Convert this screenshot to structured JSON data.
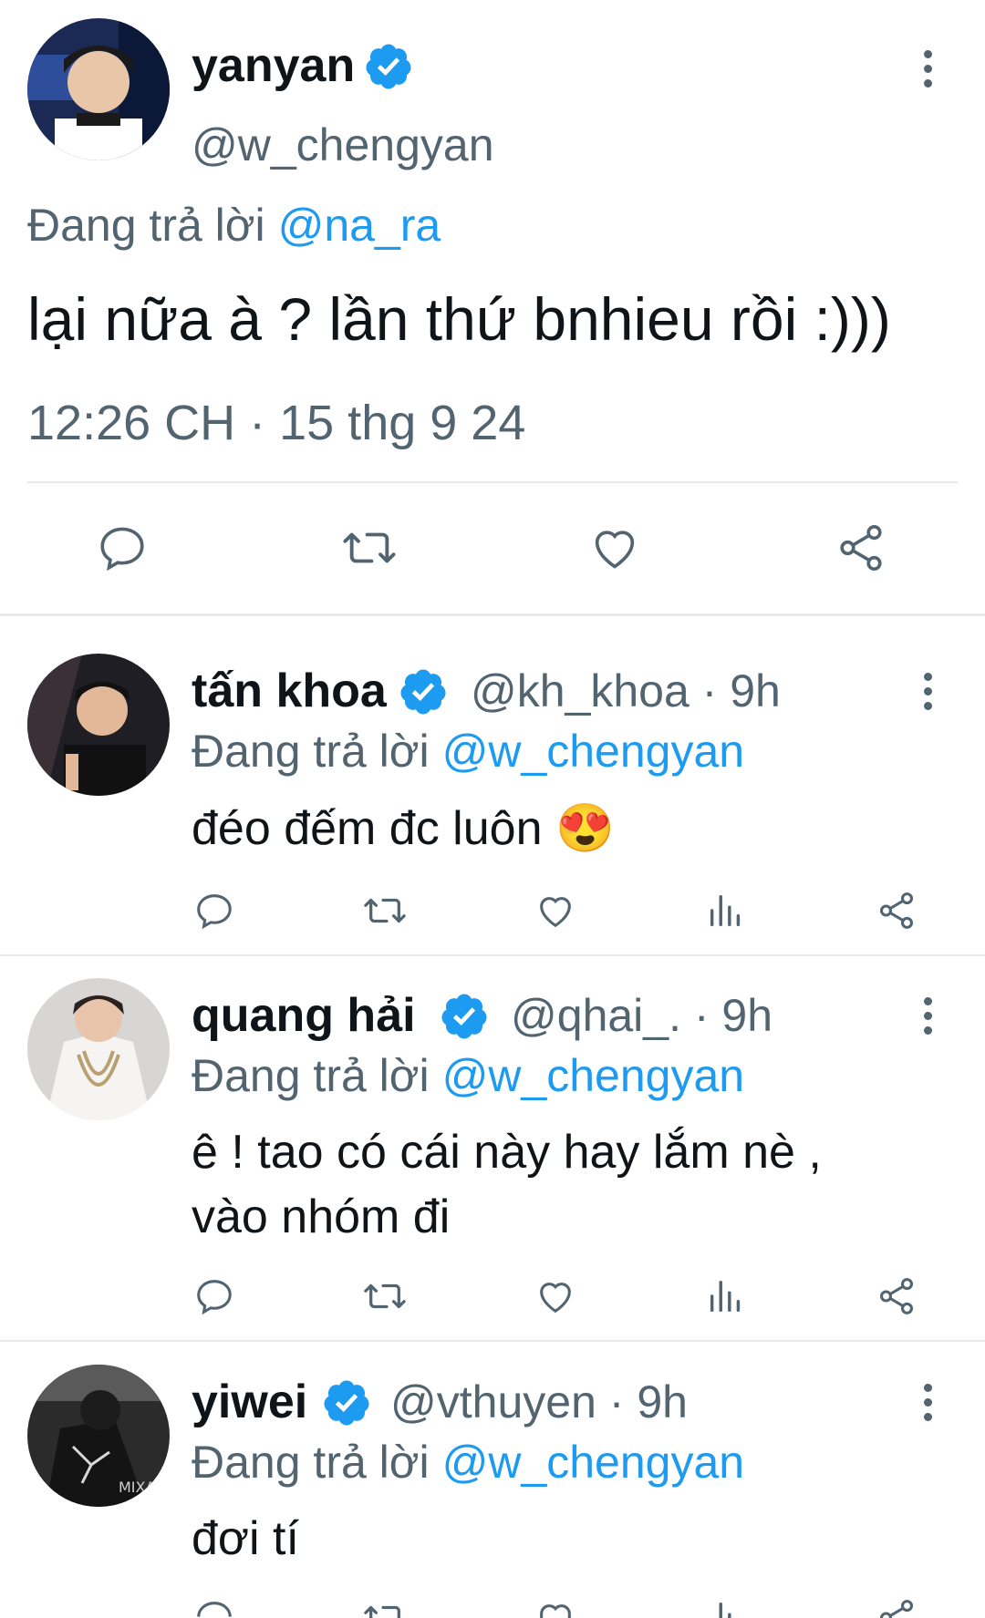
{
  "main_tweet": {
    "name": "yanyan",
    "handle": "@w_chengyan",
    "reply_prefix": "Đang trả lời",
    "reply_mention": "@na_ra",
    "text": "lại nữa à ? lần thứ bnhieu rồi :)))",
    "timestamp": "12:26 CH · 15 thg 9 24"
  },
  "replies": [
    {
      "name": "tấn khoa",
      "meta": "@kh_khoa · 9h",
      "reply_prefix": "Đang trả lời",
      "reply_mention": "@w_chengyan",
      "text": "đéo đếm đc luôn 😍"
    },
    {
      "name": "quang hải",
      "meta": "@qhai_. · 9h",
      "reply_prefix": "Đang trả lời",
      "reply_mention": "@w_chengyan",
      "text_line1": "ê ! tao có cái này hay lắm nè ,",
      "text_line2": "vào nhóm đi"
    },
    {
      "name": "yiwei",
      "meta": "@vthuyen · 9h",
      "reply_prefix": "Đang trả lời",
      "reply_mention": "@w_chengyan",
      "text": "đơi tí"
    }
  ],
  "icons": {
    "verified": "verified-badge-icon",
    "more": "more-vertical-icon",
    "reply": "reply-icon",
    "retweet": "retweet-icon",
    "like": "like-icon",
    "views": "views-icon",
    "share": "share-icon"
  },
  "colors": {
    "link": "#1d9bf0",
    "secondary_text": "#536471",
    "divider": "#e7e9ea"
  }
}
